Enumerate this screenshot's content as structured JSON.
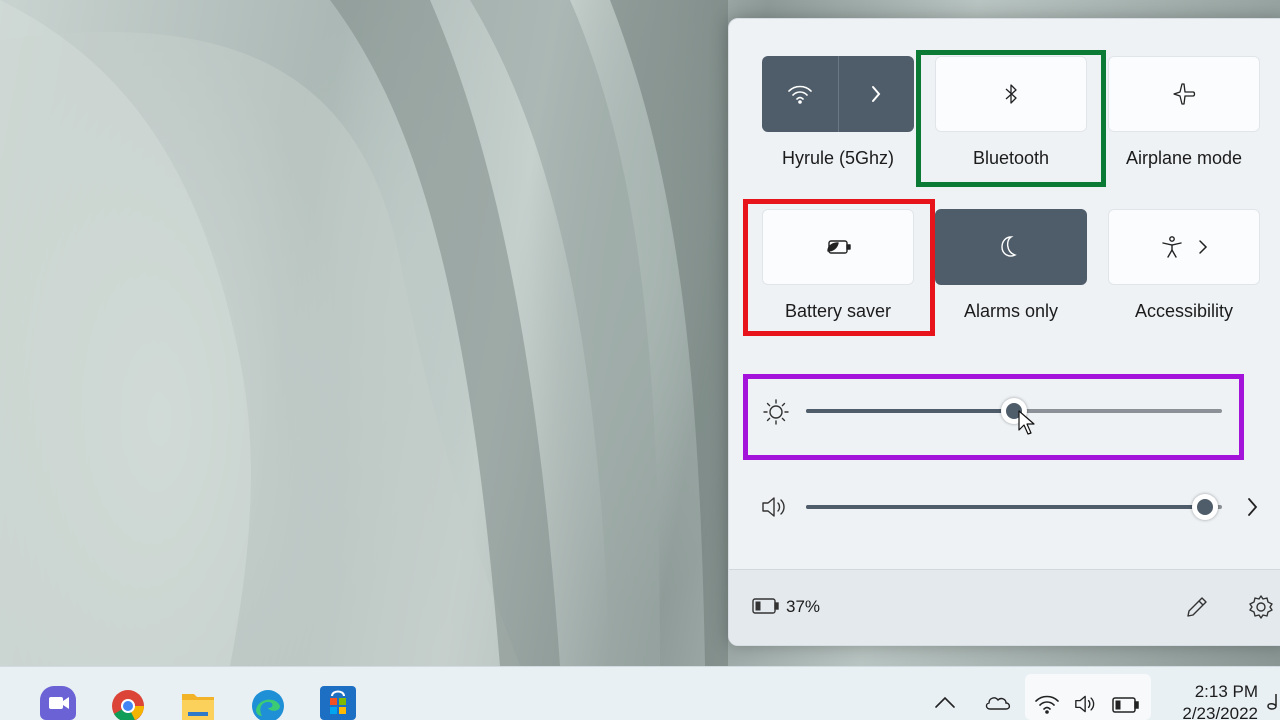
{
  "quick_settings": {
    "wifi": {
      "label": "Hyrule (5Ghz)",
      "icon": "wifi-icon",
      "state": "on"
    },
    "bluetooth": {
      "label": "Bluetooth",
      "icon": "bluetooth-icon",
      "state": "off"
    },
    "airplane": {
      "label": "Airplane mode",
      "icon": "airplane-icon",
      "state": "off"
    },
    "battery_saver": {
      "label": "Battery saver",
      "icon": "battery-saver-icon",
      "state": "off"
    },
    "focus": {
      "label": "Alarms only",
      "icon": "moon-icon",
      "state": "on"
    },
    "accessibility": {
      "label": "Accessibility",
      "icon": "accessibility-icon",
      "state": "off"
    },
    "brightness": {
      "icon": "brightness-icon",
      "level": 0.5
    },
    "volume": {
      "icon": "speaker-icon",
      "level": 0.96
    },
    "battery": {
      "icon": "battery-icon",
      "percent": "37%"
    },
    "edit_icon": "pencil-icon",
    "settings_icon": "gear-icon"
  },
  "highlights": {
    "bluetooth_color": "#0b7a34",
    "battery_saver_color": "#e8141c",
    "brightness_color": "#a313d9"
  },
  "taskbar": {
    "apps": [
      "teams-icon",
      "chrome-icon",
      "file-explorer-icon",
      "edge-icon",
      "store-icon"
    ],
    "tray": [
      "chevron-up-icon",
      "onedrive-icon",
      "wifi-icon",
      "speaker-icon",
      "battery-icon"
    ],
    "clock": {
      "time": "2:13 PM",
      "date": "2/23/2022"
    }
  },
  "colors": {
    "tile_on": "#4f5d6a",
    "tile_off": "#fbfcfd",
    "panel_bg": "#eef2f5"
  }
}
